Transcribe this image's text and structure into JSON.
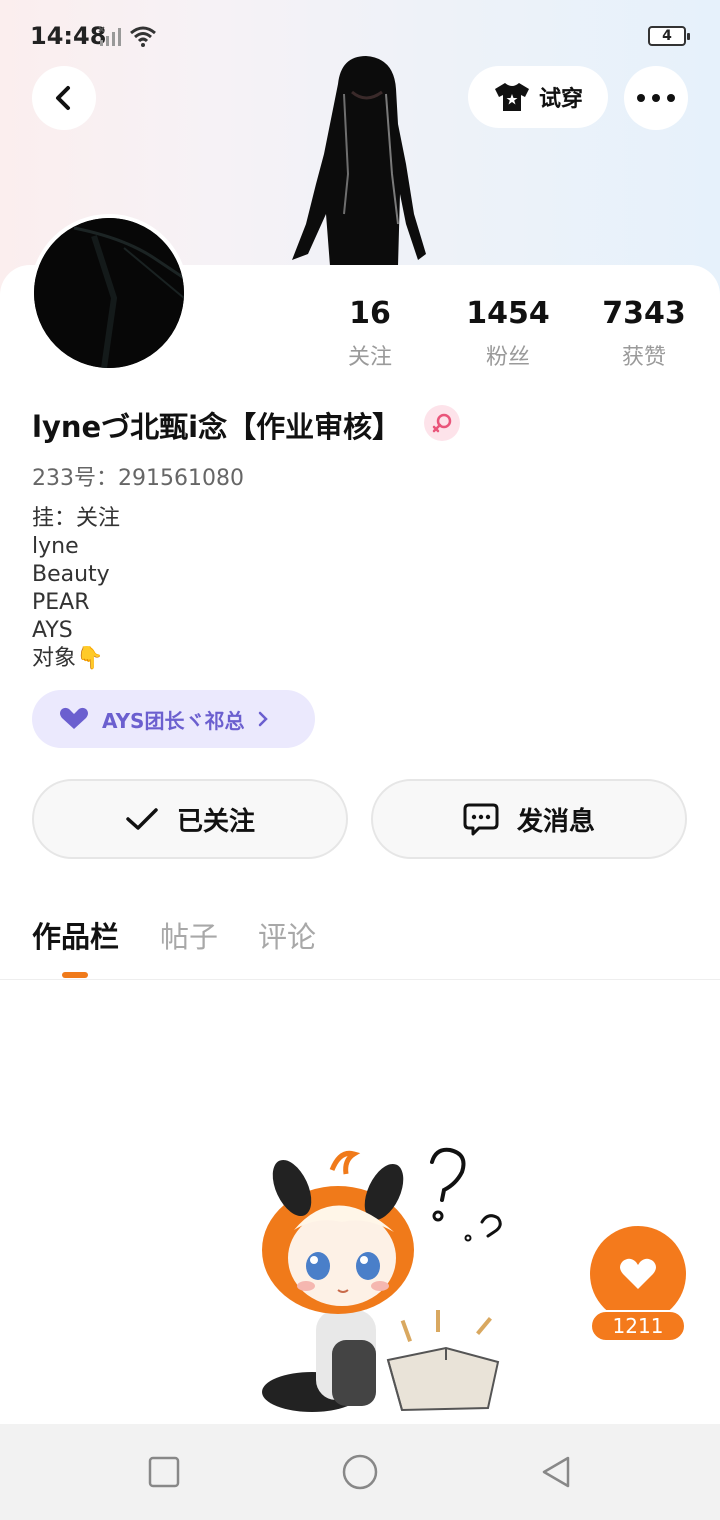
{
  "status_bar": {
    "time": "14:48",
    "battery_level": "4"
  },
  "header": {
    "tryon_label": "试穿",
    "back_icon": "chevron-left-icon",
    "more_icon": "more-horizontal-icon",
    "tryon_icon": "shirt-icon"
  },
  "profile": {
    "username": "lyneづ北甄i念【作业审核】",
    "gender": "female",
    "uid_text": "233号：291561080",
    "bio_lines": [
      "挂：关注",
      "lyne",
      "Beauty",
      "PEAR",
      "AYS",
      "对象👇"
    ],
    "guild_tag": "AYS团长ヾ祁总"
  },
  "stats": [
    {
      "value": "16",
      "label": "关注"
    },
    {
      "value": "1454",
      "label": "粉丝"
    },
    {
      "value": "7343",
      "label": "获赞"
    }
  ],
  "actions": {
    "follow_label": "已关注",
    "message_label": "发消息"
  },
  "tabs": [
    {
      "label": "作品栏",
      "active": true
    },
    {
      "label": "帖子",
      "active": false
    },
    {
      "label": "评论",
      "active": false
    }
  ],
  "like": {
    "count": "1211"
  },
  "colors": {
    "accent": "#f47a1c",
    "guild_bg": "#ebe9fd",
    "guild_text": "#6b5fcf"
  }
}
